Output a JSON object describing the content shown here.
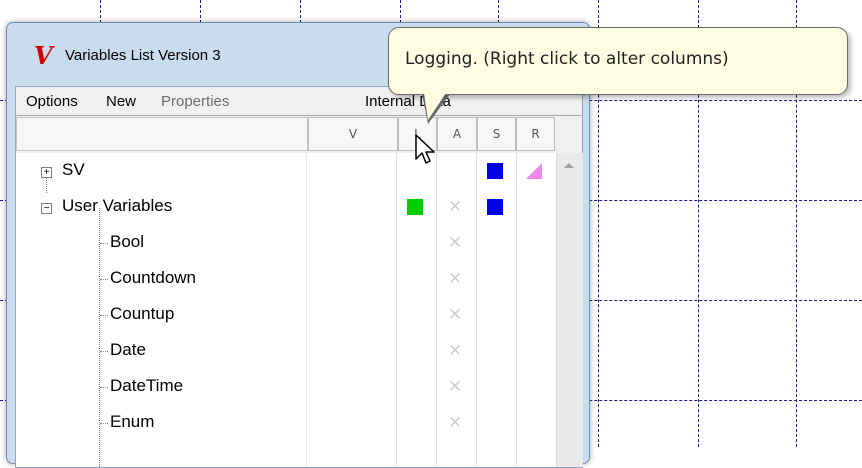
{
  "window": {
    "icon": "v-logo-icon",
    "title": "Variables List Version 3"
  },
  "menu": {
    "items": [
      {
        "label": "Options",
        "enabled": true
      },
      {
        "label": "New",
        "enabled": true
      },
      {
        "label": "Properties",
        "enabled": false
      },
      {
        "label": "Internal Data",
        "enabled": true
      }
    ]
  },
  "columns": [
    "V",
    "L",
    "A",
    "S",
    "R"
  ],
  "tooltip": {
    "text": "Logging. (Right click to alter columns)"
  },
  "tree": {
    "nodes": [
      {
        "label": "SV",
        "level": 0,
        "expander": "+",
        "L": "",
        "A": "",
        "S": "blue",
        "R": "pink-triangle"
      },
      {
        "label": "User Variables",
        "level": 0,
        "expander": "-",
        "L": "green",
        "A": "x",
        "S": "blue",
        "R": ""
      },
      {
        "label": "Bool",
        "level": 1,
        "A": "x"
      },
      {
        "label": "Countdown",
        "level": 1,
        "A": "x"
      },
      {
        "label": "Countup",
        "level": 1,
        "A": "x"
      },
      {
        "label": "Date",
        "level": 1,
        "A": "x"
      },
      {
        "label": "DateTime",
        "level": 1,
        "A": "x"
      },
      {
        "label": "Enum",
        "level": 1,
        "A": "x"
      }
    ]
  },
  "colors": {
    "green": "#00cc00",
    "blue": "#0000ee",
    "pink": "#ee88ee",
    "grid": "#1a1a8c",
    "tooltip_bg": "#fdfde2"
  }
}
